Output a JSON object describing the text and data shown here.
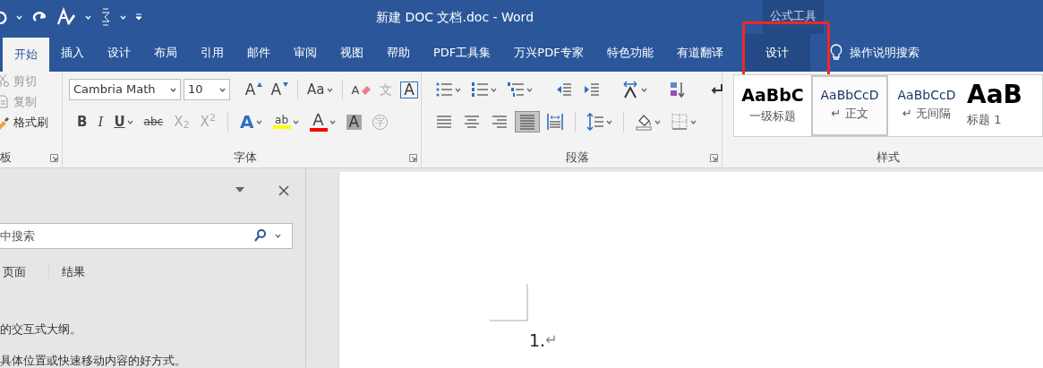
{
  "window": {
    "title": "新建 DOC 文档.doc  -  Word",
    "contextual_group": "公式工具"
  },
  "tabs": [
    {
      "label": "开始",
      "selected": true,
      "contextual": false,
      "annotated": false
    },
    {
      "label": "插入",
      "selected": false,
      "contextual": false,
      "annotated": false
    },
    {
      "label": "设计",
      "selected": false,
      "contextual": false,
      "annotated": false
    },
    {
      "label": "布局",
      "selected": false,
      "contextual": false,
      "annotated": false
    },
    {
      "label": "引用",
      "selected": false,
      "contextual": false,
      "annotated": false
    },
    {
      "label": "邮件",
      "selected": false,
      "contextual": false,
      "annotated": false
    },
    {
      "label": "审阅",
      "selected": false,
      "contextual": false,
      "annotated": false
    },
    {
      "label": "视图",
      "selected": false,
      "contextual": false,
      "annotated": false
    },
    {
      "label": "帮助",
      "selected": false,
      "contextual": false,
      "annotated": false
    },
    {
      "label": "PDF工具集",
      "selected": false,
      "contextual": false,
      "annotated": false
    },
    {
      "label": "万兴PDF专家",
      "selected": false,
      "contextual": false,
      "annotated": false
    },
    {
      "label": "特色功能",
      "selected": false,
      "contextual": false,
      "annotated": false
    },
    {
      "label": "有道翻译",
      "selected": false,
      "contextual": false,
      "annotated": false
    },
    {
      "label": "设计",
      "selected": false,
      "contextual": true,
      "annotated": true
    }
  ],
  "tell_me": "操作说明搜索",
  "clipboard": {
    "label": "板",
    "items": [
      {
        "kind": "cut",
        "label": "剪切",
        "disabled": true
      },
      {
        "kind": "copy",
        "label": "复制",
        "disabled": true
      },
      {
        "kind": "painter",
        "label": "格式刷",
        "disabled": false
      }
    ]
  },
  "font": {
    "label": "字体",
    "font_name": "Cambria Math",
    "font_size": "10",
    "row1": [
      {
        "kind": "grow",
        "label": "A",
        "disabled": false,
        "dropdown": false
      },
      {
        "kind": "shrink",
        "label": "A",
        "disabled": false,
        "dropdown": false
      },
      {
        "kind": "sep"
      },
      {
        "kind": "case",
        "label": "Aa",
        "disabled": false,
        "dropdown": true
      },
      {
        "kind": "sep"
      },
      {
        "kind": "clear",
        "label": "A",
        "disabled": false,
        "dropdown": false
      },
      {
        "kind": "phonetic",
        "label": "文",
        "disabled": true,
        "dropdown": false
      },
      {
        "kind": "border",
        "label": "A",
        "disabled": false,
        "dropdown": false
      }
    ],
    "row2": [
      {
        "kind": "bold",
        "label": "B",
        "disabled": false,
        "dropdown": false
      },
      {
        "kind": "italic",
        "label": "I",
        "disabled": false,
        "dropdown": false
      },
      {
        "kind": "underline",
        "label": "U",
        "disabled": false,
        "dropdown": true
      },
      {
        "kind": "strike",
        "label": "abc",
        "disabled": false,
        "dropdown": false
      },
      {
        "kind": "script",
        "label": "X$_{2}$",
        "disabled": true,
        "dropdown": false
      },
      {
        "kind": "script",
        "label": "X$^{2}$",
        "disabled": true,
        "dropdown": false
      },
      {
        "kind": "sep"
      },
      {
        "kind": "effects",
        "label": "A",
        "disabled": false,
        "dropdown": true
      },
      {
        "kind": "highlight",
        "label": "ab",
        "disabled": false,
        "dropdown": true,
        "color": "#ffff00"
      },
      {
        "kind": "fontcolor",
        "label": "A",
        "disabled": false,
        "dropdown": true,
        "color": "#ff0000"
      },
      {
        "kind": "shading",
        "label": "A",
        "disabled": false,
        "dropdown": false
      },
      {
        "kind": "enclose",
        "label": "字",
        "disabled": true,
        "dropdown": false
      }
    ]
  },
  "paragraph": {
    "label": "段落",
    "row1": [
      {
        "kind": "bullets",
        "dropdown": true
      },
      {
        "kind": "numbering",
        "dropdown": true
      },
      {
        "kind": "multilevel",
        "dropdown": true
      },
      {
        "kind": "sep"
      },
      {
        "kind": "outdent",
        "dropdown": false
      },
      {
        "kind": "indent",
        "dropdown": false
      },
      {
        "kind": "sep"
      },
      {
        "kind": "textdir",
        "dropdown": true
      },
      {
        "kind": "sep"
      },
      {
        "kind": "sort",
        "dropdown": false
      },
      {
        "kind": "sep"
      },
      {
        "kind": "marks",
        "dropdown": false
      }
    ],
    "row2": [
      {
        "kind": "left",
        "dropdown": false,
        "selected": false
      },
      {
        "kind": "center",
        "dropdown": false,
        "selected": false
      },
      {
        "kind": "right",
        "dropdown": false,
        "selected": false
      },
      {
        "kind": "justify",
        "dropdown": false,
        "selected": true
      },
      {
        "kind": "distributed",
        "dropdown": false,
        "selected": false
      },
      {
        "kind": "sep"
      },
      {
        "kind": "linespacing",
        "dropdown": true
      },
      {
        "kind": "sep"
      },
      {
        "kind": "fill",
        "dropdown": true
      },
      {
        "kind": "borders",
        "dropdown": true
      }
    ]
  },
  "styles": {
    "label": "样式",
    "items": [
      {
        "kind": "heading",
        "preview": "AaBbC",
        "name": "一级标题",
        "selected": false
      },
      {
        "kind": "normal",
        "preview": "AaBbCcD",
        "name": "↵ 正文",
        "selected": true
      },
      {
        "kind": "normal",
        "preview": "AaBbCcD",
        "name": "↵ 无间隔",
        "selected": false
      },
      {
        "kind": "title",
        "preview": "AaB",
        "name": "标题 1",
        "selected": false
      }
    ]
  },
  "nav_pane": {
    "search": {
      "placeholder": "中搜索"
    },
    "tabs": [
      "页面",
      "结果"
    ],
    "lines": [
      "的交互式大纲。",
      "具体位置或快速移动内容的好方式。"
    ]
  },
  "document": {
    "number": "1.",
    "mark": "↵"
  }
}
